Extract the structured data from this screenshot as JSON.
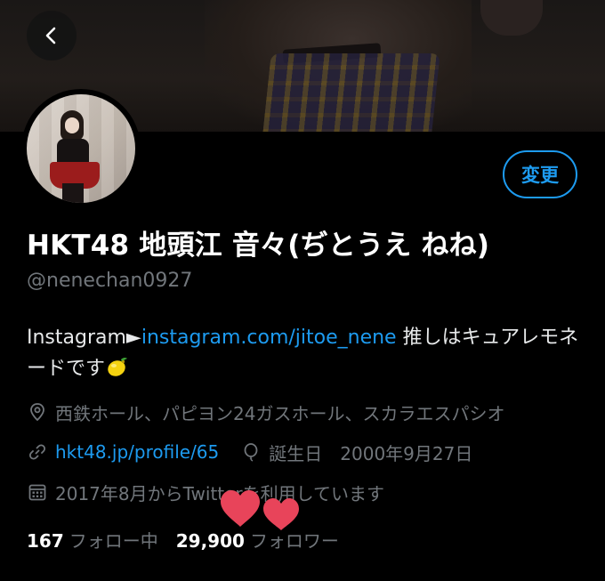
{
  "header": {
    "back_icon": "chevron-left-icon"
  },
  "profile": {
    "edit_button": "変更",
    "display_name": "HKT48 地頭江 音々(ぢとうえ ねね)",
    "handle": "@nenechan0927",
    "bio": {
      "prefix": "Instagram►",
      "link": "instagram.com/jitoe_nene",
      "suffix": " 推しはキュアレモネードです"
    },
    "location": "西鉄ホール、パピヨン24ガスホール、スカラエスパシオ",
    "website": "hkt48.jp/profile/65",
    "birthday": "誕生日　2000年9月27日",
    "joined": "2017年8月からTwitterを利用しています"
  },
  "stats": {
    "following_count": "167",
    "following_label": "フォロー中",
    "followers_count": "29,900",
    "followers_label": "フォロワー"
  },
  "colors": {
    "accent": "#1d9bf0",
    "muted": "#71767b",
    "heart": "#e8445a"
  }
}
